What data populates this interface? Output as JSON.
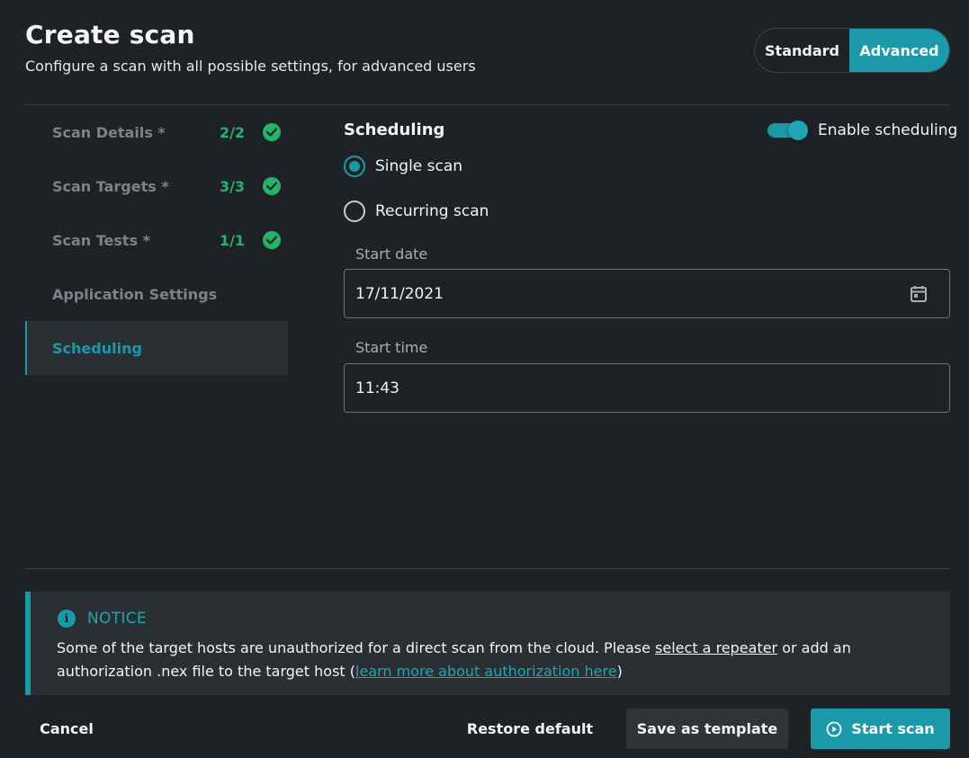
{
  "header": {
    "title": "Create scan",
    "subtitle": "Configure a scan with all possible settings, for advanced users",
    "mode_standard": "Standard",
    "mode_advanced": "Advanced",
    "active_mode": "Advanced"
  },
  "sidebar": {
    "items": [
      {
        "label": "Scan Details *",
        "count": "2/2",
        "complete": true
      },
      {
        "label": "Scan Targets *",
        "count": "3/3",
        "complete": true
      },
      {
        "label": "Scan Tests *",
        "count": "1/1",
        "complete": true
      },
      {
        "label": "Application Settings",
        "count": "",
        "complete": false
      },
      {
        "label": "Scheduling",
        "count": "",
        "complete": false,
        "active": true
      }
    ]
  },
  "scheduling": {
    "title": "Scheduling",
    "enable_label": "Enable scheduling",
    "enabled": true,
    "options": [
      {
        "label": "Single scan",
        "selected": true
      },
      {
        "label": "Recurring scan",
        "selected": false
      }
    ],
    "start_date_label": "Start date",
    "start_date_value": "17/11/2021",
    "start_time_label": "Start time",
    "start_time_value": "11:43"
  },
  "notice": {
    "title": "NOTICE",
    "text_before": "Some of the target hosts are unauthorized for a direct scan from the cloud. Please ",
    "link_repeater": "select a repeater",
    "text_middle": " or add an authorization .nex file to the target host (",
    "link_learn": "learn more about authorization here",
    "text_after": ")"
  },
  "footer": {
    "cancel": "Cancel",
    "restore": "Restore default",
    "save_template": "Save as template",
    "start_scan": "Start scan"
  },
  "colors": {
    "accent": "#1a9aa8",
    "success": "#23b46a",
    "background": "#1e2226",
    "panel": "#2a2f34"
  }
}
